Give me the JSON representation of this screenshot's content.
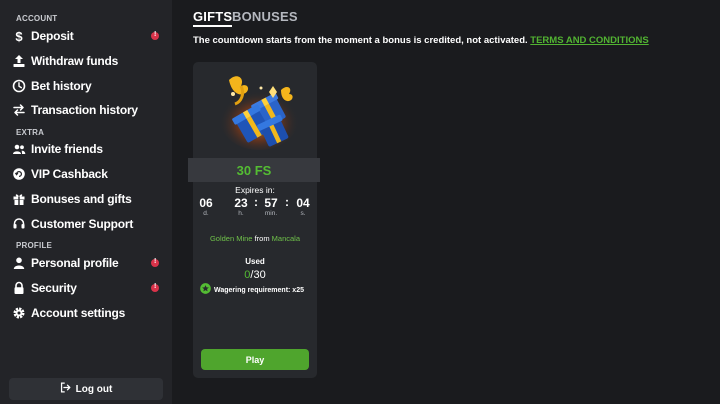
{
  "sidebar": {
    "sections": {
      "account": "ACCOUNT",
      "extra": "EXTRA",
      "profile": "PROFILE"
    },
    "items": [
      {
        "label": "Deposit",
        "icon": "dollar-icon",
        "alert": true
      },
      {
        "label": "Withdraw funds",
        "icon": "upload-icon",
        "alert": false
      },
      {
        "label": "Bet history",
        "icon": "clock-icon",
        "alert": false
      },
      {
        "label": "Transaction history",
        "icon": "transfer-arrows-icon",
        "alert": false
      },
      {
        "label": "Invite friends",
        "icon": "users-icon",
        "alert": false
      },
      {
        "label": "VIP Cashback",
        "icon": "cashback-icon",
        "alert": false
      },
      {
        "label": "Bonuses and gifts",
        "icon": "gift-icon",
        "alert": false
      },
      {
        "label": "Customer Support",
        "icon": "headset-icon",
        "alert": false
      },
      {
        "label": "Personal profile",
        "icon": "user-icon",
        "alert": true
      },
      {
        "label": "Security",
        "icon": "lock-icon",
        "alert": true
      },
      {
        "label": "Account settings",
        "icon": "gear-icon",
        "alert": false
      }
    ],
    "logout_label": "Log out"
  },
  "tabs": {
    "gifts": "GIFTS",
    "bonuses": "BONUSES"
  },
  "notice": {
    "text": "The countdown starts from the moment a bonus is credited, not activated.",
    "link": "TERMS AND CONDITIONS"
  },
  "card": {
    "title": "30 FS",
    "expires_label": "Expires in:",
    "countdown": {
      "days": "06",
      "days_unit": "d.",
      "hours": "23",
      "hours_unit": "h.",
      "minutes": "57",
      "minutes_unit": "min.",
      "seconds": "04",
      "seconds_unit": "s."
    },
    "game": "Golden Mine",
    "from": "from",
    "provider": "Mancala",
    "used_label": "Used",
    "used_count": "0",
    "used_total": "/30",
    "wagering": "Wagering requirement: x25",
    "play_label": "Play"
  },
  "colors": {
    "accent_green": "#54bd33",
    "alert_red": "#d9334a",
    "play_button": "#4fa52d"
  }
}
